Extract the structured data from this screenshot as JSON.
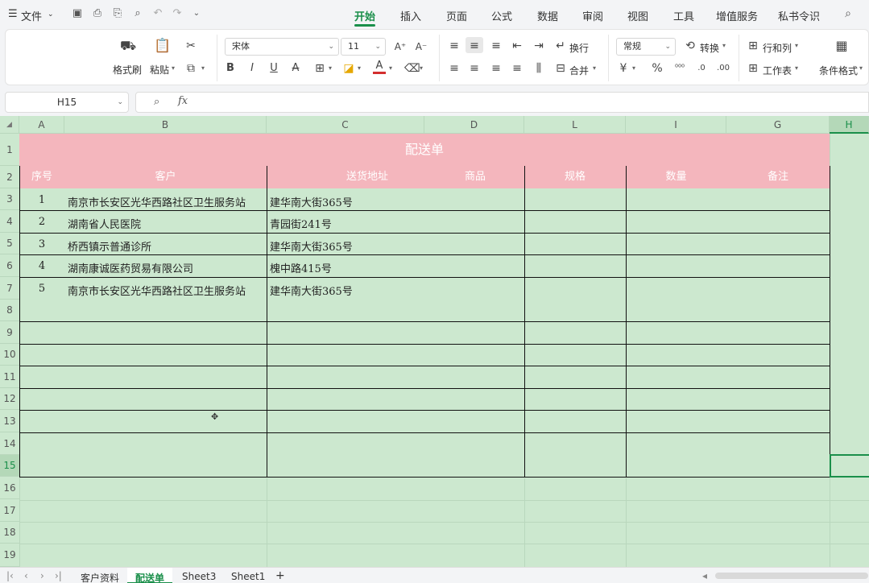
{
  "menubar": {
    "menu_icon": "☰",
    "file_label": "文件",
    "tabs": [
      {
        "label": "开始",
        "active": true
      },
      {
        "label": "插入",
        "active": false
      },
      {
        "label": "页面",
        "active": false
      },
      {
        "label": "公式",
        "active": false
      },
      {
        "label": "数据",
        "active": false
      },
      {
        "label": "审阅",
        "active": false
      },
      {
        "label": "视图",
        "active": false
      },
      {
        "label": "工具",
        "active": false
      },
      {
        "label": "增值服务",
        "active": false
      },
      {
        "label": "私书令识",
        "active": false
      }
    ]
  },
  "ribbon": {
    "format_painter": "格式刷",
    "paste": "粘贴",
    "font_name": "宋体",
    "font_size": "11",
    "wrap": "换行",
    "merge": "合并",
    "number_format": "常规",
    "convert": "转换",
    "rows_cols": "行和列",
    "worksheet": "工作表",
    "conditional": "条件格式",
    "bold": "B",
    "italic": "I",
    "underline": "U",
    "currency": "¥",
    "percent": "%"
  },
  "formula_bar": {
    "cell_ref": "H15",
    "fx": "fx"
  },
  "columns": [
    "A",
    "B",
    "C",
    "D",
    "L",
    "I",
    "G",
    "H"
  ],
  "rows": [
    "1",
    "2",
    "3",
    "4",
    "5",
    "6",
    "7",
    "8",
    "9",
    "10",
    "11",
    "12",
    "13",
    "14",
    "15",
    "16",
    "17",
    "18",
    "19"
  ],
  "sheet": {
    "title": "配送单",
    "headers": {
      "seq": "序号",
      "customer": "客户",
      "address": "送货地址",
      "product": "商品",
      "spec": "规格",
      "qty": "数量",
      "note": "备注"
    },
    "records": [
      {
        "seq": "1",
        "customer": "南京市长安区光华西路社区卫生服务站",
        "address": "建华南大街365号"
      },
      {
        "seq": "2",
        "customer": "湖南省人民医院",
        "address": "青园街241号"
      },
      {
        "seq": "3",
        "customer": "桥西镇示普通诊所",
        "address": "建华南大街365号"
      },
      {
        "seq": "4",
        "customer": "湖南康诚医药贸易有限公司",
        "address": "槐中路415号"
      },
      {
        "seq": "5",
        "customer": "南京市长安区光华西路社区卫生服务站",
        "address": "建华南大街365号"
      }
    ]
  },
  "sheet_tabs": [
    {
      "label": "客户资料",
      "active": false
    },
    {
      "label": "配送单",
      "active": true
    },
    {
      "label": "Sheet3",
      "active": false
    },
    {
      "label": "Sheet1",
      "active": false
    }
  ],
  "add_sheet": "+",
  "colors": {
    "accent": "#1a8f4a",
    "header_pink": "#f4b6bd",
    "sheet_green": "#cce8cf"
  }
}
